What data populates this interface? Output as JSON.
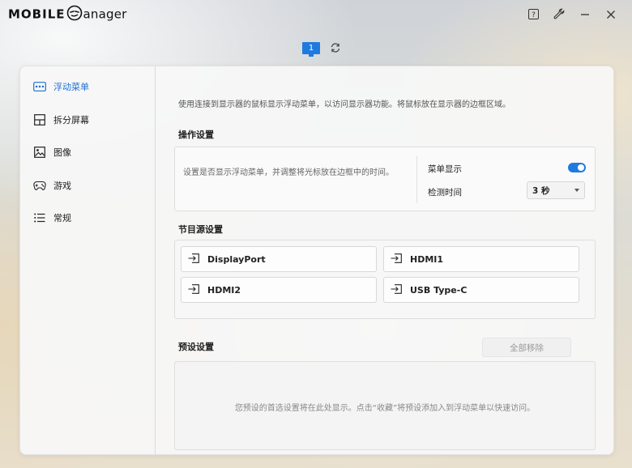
{
  "app": {
    "title_mark": "MOBILE",
    "title_suffix": "anager"
  },
  "titlebar": {
    "help_icon": "help-icon",
    "settings_icon": "wrench-icon",
    "minimize_icon": "minimize-icon",
    "close_icon": "close-icon"
  },
  "monitor": {
    "number": "1",
    "refresh_icon": "refresh-icon"
  },
  "sidebar": {
    "items": [
      {
        "label": "浮动菜单",
        "icon": "menu-card-icon",
        "active": true
      },
      {
        "label": "拆分屏幕",
        "icon": "split-screen-icon",
        "active": false
      },
      {
        "label": "图像",
        "icon": "image-icon",
        "active": false
      },
      {
        "label": "游戏",
        "icon": "gamepad-icon",
        "active": false
      },
      {
        "label": "常规",
        "icon": "list-icon",
        "active": false
      }
    ]
  },
  "main": {
    "description": "使用连接到显示器的鼠标显示浮动菜单，以访问显示器功能。将鼠标放在显示器的边框区域。",
    "operation": {
      "title": "操作设置",
      "help": "设置是否显示浮动菜单，并调整将光标放在边框中的时间。",
      "menu_display_label": "菜单显示",
      "menu_display_on": true,
      "detect_time_label": "检测时间",
      "detect_time_value": "3 秒"
    },
    "source": {
      "title": "节目源设置",
      "items": [
        {
          "label": "DisplayPort"
        },
        {
          "label": "HDMI1"
        },
        {
          "label": "HDMI2"
        },
        {
          "label": "USB Type-C"
        }
      ]
    },
    "preset": {
      "title": "预设设置",
      "remove_all_label": "全部移除",
      "empty_message": "您预设的首选设置将在此处显示。点击“收藏”将预设添加入到浮动菜单以快速访问。"
    }
  },
  "colors": {
    "accent": "#1f7ae0",
    "active_text": "#1f6fd1"
  }
}
